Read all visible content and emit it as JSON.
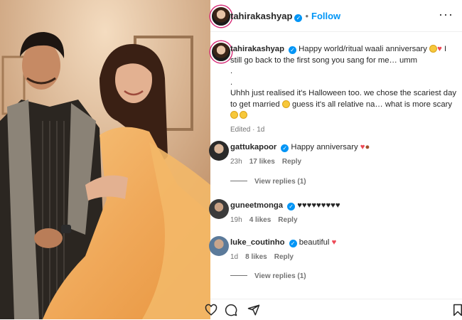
{
  "post": {
    "username": "tahirakashyap",
    "follow_label": "Follow",
    "separator": "•",
    "more_label": "···"
  },
  "caption": {
    "username": "tahirakashyap",
    "line1": "Happy world/ritual waali anniversary",
    "line2": "I still go back to the first song you sang for me… umm",
    "dot1": ".",
    "dot2": ".",
    "line3": "Uhhh just realised it's Halloween too. we chose the scariest day to get married",
    "line4": "guess it's all relative na… what is more scary",
    "edited": "Edited",
    "time": "1d"
  },
  "comments": [
    {
      "username": "gattukapoor",
      "text": "Happy anniversary",
      "time": "23h",
      "likes": "17 likes",
      "reply": "Reply",
      "view_replies": "View replies (1)"
    },
    {
      "username": "guneetmonga",
      "text": "♥♥♥♥♥♥♥♥♥",
      "time": "19h",
      "likes": "4 likes",
      "reply": "Reply"
    },
    {
      "username": "luke_coutinho",
      "text": "beautiful",
      "time": "1d",
      "likes": "8 likes",
      "reply": "Reply",
      "view_replies": "View replies (1)"
    }
  ],
  "icons": {
    "verified": "verified-badge-icon",
    "heart": "heart-icon",
    "comment": "comment-icon",
    "share": "share-icon",
    "save": "bookmark-icon"
  },
  "colors": {
    "accent": "#0095f6",
    "heart": "#ed4956",
    "muted": "#737373"
  }
}
